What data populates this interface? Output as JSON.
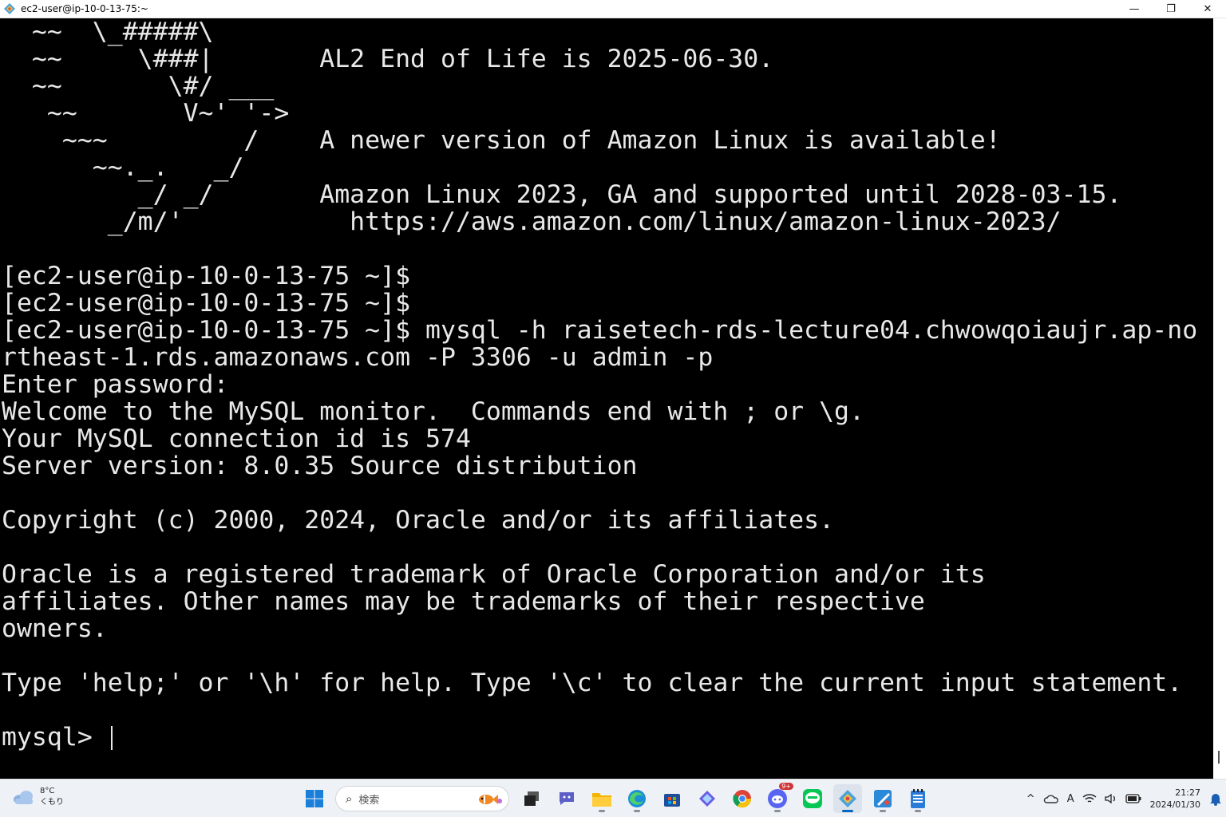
{
  "window": {
    "title": "ec2-user@ip-10-0-13-75:~",
    "controls": {
      "minimize": "—",
      "maximize": "❐",
      "close": "✕"
    }
  },
  "terminal": {
    "lines": [
      "  ~~  \\_#####\\",
      "  ~~     \\###|       AL2 End of Life is 2025-06-30.",
      "  ~~       \\#/ ___",
      "   ~~       V~' '->",
      "    ~~~         /    A newer version of Amazon Linux is available!",
      "      ~~._.   _/",
      "         _/ _/       Amazon Linux 2023, GA and supported until 2028-03-15.",
      "       _/m/'           https://aws.amazon.com/linux/amazon-linux-2023/",
      "",
      "[ec2-user@ip-10-0-13-75 ~]$",
      "[ec2-user@ip-10-0-13-75 ~]$",
      "[ec2-user@ip-10-0-13-75 ~]$ mysql -h raisetech-rds-lecture04.chwowqoiaujr.ap-no",
      "rtheast-1.rds.amazonaws.com -P 3306 -u admin -p",
      "Enter password:",
      "Welcome to the MySQL monitor.  Commands end with ; or \\g.",
      "Your MySQL connection id is 574",
      "Server version: 8.0.35 Source distribution",
      "",
      "Copyright (c) 2000, 2024, Oracle and/or its affiliates.",
      "",
      "Oracle is a registered trademark of Oracle Corporation and/or its",
      "affiliates. Other names may be trademarks of their respective",
      "owners.",
      "",
      "Type 'help;' or '\\h' for help. Type '\\c' to clear the current input statement.",
      "",
      "mysql> "
    ]
  },
  "taskbar": {
    "weather": {
      "temp": "8°C",
      "condition": "くもり"
    },
    "search": {
      "placeholder": "検索"
    },
    "apps": [
      {
        "name": "start-icon",
        "running": false,
        "active": false
      },
      {
        "name": "task-view-icon",
        "running": false,
        "active": false
      },
      {
        "name": "teams-chat-icon",
        "running": false,
        "active": false
      },
      {
        "name": "file-explorer-icon",
        "running": true,
        "active": false
      },
      {
        "name": "edge-icon",
        "running": true,
        "active": false
      },
      {
        "name": "store-icon",
        "running": false,
        "active": false
      },
      {
        "name": "copilot-icon",
        "running": false,
        "active": false
      },
      {
        "name": "chrome-icon",
        "running": false,
        "active": false
      },
      {
        "name": "discord-icon",
        "running": true,
        "active": false,
        "badge": "9+"
      },
      {
        "name": "line-icon",
        "running": false,
        "active": false
      },
      {
        "name": "tera-term-icon",
        "running": true,
        "active": true
      },
      {
        "name": "paint-icon",
        "running": true,
        "active": false
      },
      {
        "name": "notepad-icon",
        "running": true,
        "active": false
      }
    ],
    "tray": {
      "chevron": "^",
      "ime": "A",
      "time": "21:27",
      "date": "2024/01/30"
    }
  }
}
